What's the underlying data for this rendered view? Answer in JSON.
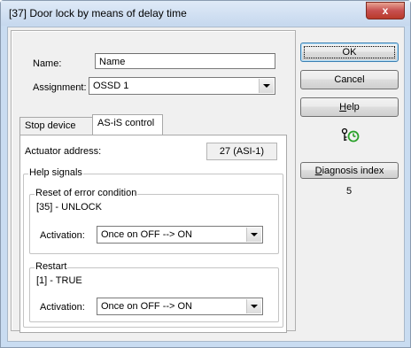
{
  "window": {
    "title": "[37] Door lock by means of delay time",
    "close_glyph": "x"
  },
  "form": {
    "name_label": "Name:",
    "name_value": "Name",
    "assignment_label": "Assignment:",
    "assignment_value": "OSSD 1"
  },
  "tabs": [
    {
      "label": "Stop device",
      "active": false
    },
    {
      "label": "AS-iS control",
      "active": true
    }
  ],
  "asi": {
    "actuator_label": "Actuator address:",
    "actuator_value": "27 (ASI-1)",
    "help_signals_title": "Help signals",
    "reset": {
      "title": "Reset of error condition",
      "signal": "[35] - UNLOCK",
      "activation_label": "Activation:",
      "activation_value": "Once on OFF --> ON"
    },
    "restart": {
      "title": "Restart",
      "signal": "[1] - TRUE",
      "activation_label": "Activation:",
      "activation_value": "Once on OFF --> ON"
    }
  },
  "buttons": {
    "ok": "OK",
    "cancel": "Cancel",
    "help_underlined": "H",
    "help_rest": "elp",
    "diagnosis_underlined": "D",
    "diagnosis_rest": "iagnosis index"
  },
  "diagnosis_value": "5",
  "icons": {
    "status": "key-timer-icon"
  },
  "colors": {
    "status_green": "#2aa12a",
    "titlebar": "#c9dcf1"
  }
}
